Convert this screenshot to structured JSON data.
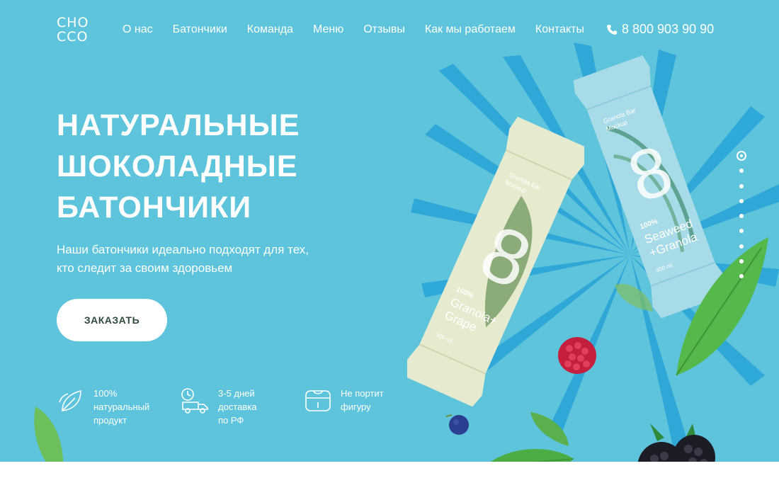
{
  "header": {
    "logo_line1": "CHO",
    "logo_line2": "CCO",
    "nav": [
      "О нас",
      "Батончики",
      "Команда",
      "Меню",
      "Отзывы",
      "Как мы работаем",
      "Контакты"
    ],
    "phone": "8 800 903 90 90",
    "phone_icon": "phone-icon"
  },
  "hero": {
    "title_line1": "НАТУРАЛЬНЫЕ",
    "title_line2": "ШОКОЛАДНЫЕ",
    "title_line3": "БАТОНЧИКИ",
    "subtitle": "Наши батончики идеально подходят для тех, кто следит за своим здоровьем",
    "order_button": "ЗАКАЗАТЬ"
  },
  "features": [
    {
      "icon": "leaf-icon",
      "text": "100%\nнатуральный\nпродукт"
    },
    {
      "icon": "delivery-truck-icon",
      "text": "3-5 дней\nдоставка\nпо РФ"
    },
    {
      "icon": "scale-icon",
      "text": "Не портит\nфигуру"
    }
  ],
  "products": {
    "bar1": {
      "label": "Granola Bar\nMockup",
      "number": "8",
      "percent": "100%",
      "name_line1": "Granola+",
      "name_line2": "Grape",
      "volume": "300 ml"
    },
    "bar2": {
      "label": "Granola Bar\nMockup",
      "number": "8",
      "percent": "100%",
      "name_line1": "Seaweed",
      "name_line2": "+Granola",
      "volume": "300 ml"
    }
  },
  "slider": {
    "count": 9,
    "active_index": 0
  },
  "colors": {
    "background": "#5ec4dc",
    "button_text": "#2e4a3a",
    "bar1": "#e6ebcf",
    "bar2": "#a8dbe8"
  }
}
